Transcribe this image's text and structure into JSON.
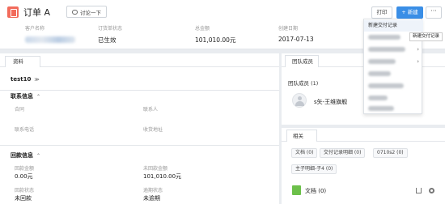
{
  "header": {
    "title": "订单 A",
    "discuss_label": "讨论一下",
    "print_label": "打印",
    "new_label": "+ 新建",
    "more_label": "···"
  },
  "fields": {
    "customer_label": "客户名称",
    "status_label": "订货单状态",
    "status_value": "已生效",
    "amount_label": "总金额",
    "amount_value": "101,010.00元",
    "date_label": "创建日期",
    "date_value": "2017-07-13"
  },
  "dropdown": {
    "first_item": "新建交付记录",
    "tooltip": "新建交付记录"
  },
  "left": {
    "tab_label": "资料",
    "record_name": "test10",
    "contact_section": "联系信息",
    "contract_label": "合同",
    "contact_label": "联系人",
    "phone_label": "联系电话",
    "address_label": "收货地址",
    "payment_section": "回款信息",
    "paid_label": "回款金额",
    "paid_value": "0.00元",
    "unpaid_label": "未回款金额",
    "unpaid_value": "101,010.00元",
    "pay_status_label": "回款状态",
    "pay_status_value": "未回款",
    "overdue_label": "逾期状态",
    "overdue_value": "未逾期"
  },
  "team": {
    "tab_label": "团队成员",
    "members_label": "团队成员 (1)",
    "member_name": "s矢-王维旗舰"
  },
  "related": {
    "tab_label": "相关",
    "chips": [
      "文档 (0)",
      "交付记录明细 (0)",
      "0710s2 (0)",
      "主子明细-子4 (0)"
    ],
    "docs_title": "文档 (0)"
  },
  "colors": {
    "accent": "#3a8ee6",
    "order_icon": "#f26b5b",
    "doc_icon": "#6cc04a"
  }
}
